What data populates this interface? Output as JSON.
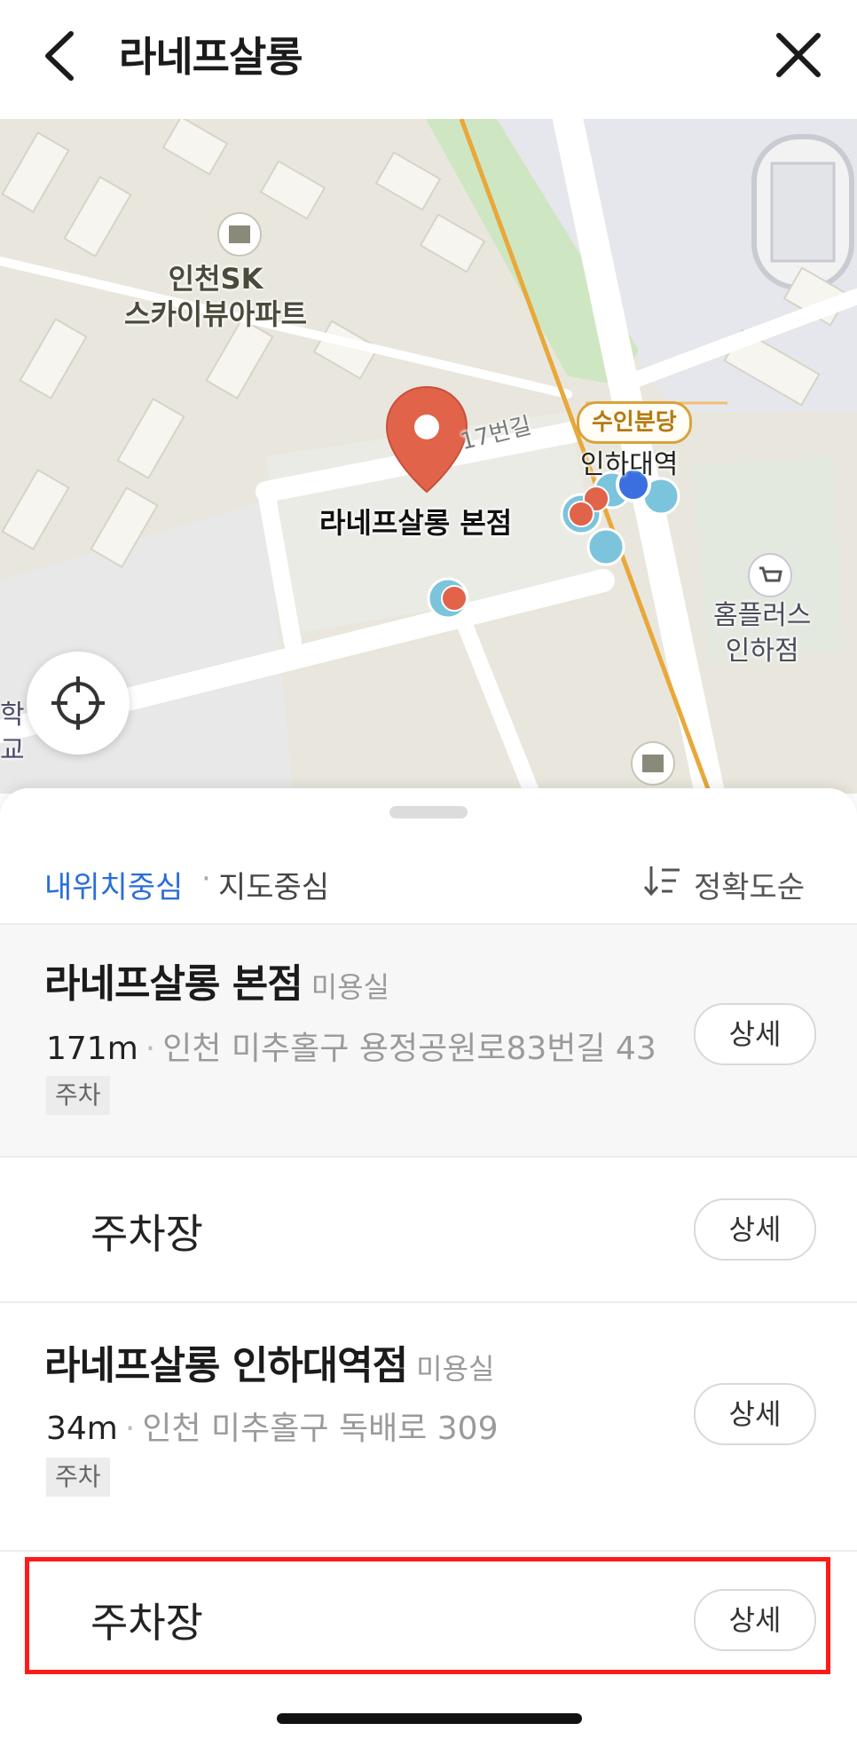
{
  "header": {
    "title": "라네프살롱",
    "back_icon": "chevron-left-icon",
    "close_icon": "close-icon"
  },
  "map": {
    "apartment_label_line1": "인천SK",
    "apartment_label_line2": "스카이뷰아파트",
    "road_label": "17번길",
    "station_badge": "수인분당",
    "station_name": "인하대역",
    "place_label": "라네프살롱 본점",
    "shop_label_line1": "홈플러스",
    "shop_label_line2": "인하점",
    "edge_label_line1": "학",
    "edge_label_line2": "교",
    "locate_icon": "crosshair-icon",
    "colors": {
      "marker": "#e0634a",
      "pin_blue": "#7cc4dc",
      "current_location": "#3b6fe0",
      "transit_line": "#e8a83a"
    }
  },
  "filters": {
    "my_location": "내위치중심",
    "map_center": "지도중심",
    "separator": "·",
    "sort_label": "정확도순",
    "sort_icon": "sort-descending-icon"
  },
  "results": [
    {
      "name": "라네프살롱 본점",
      "category": "미용실",
      "distance": "171m",
      "address": "인천 미추홀구 용정공원로83번길 43",
      "tag": "주차",
      "detail": "상세"
    },
    {
      "sub_label": "주차장",
      "detail": "상세"
    },
    {
      "name": "라네프살롱 인하대역점",
      "category": "미용실",
      "distance": "34m",
      "address": "인천 미추홀구 독배로 309",
      "tag": "주차",
      "detail": "상세"
    },
    {
      "sub_label": "주차장",
      "detail": "상세"
    }
  ],
  "colors": {
    "accent": "#2a6ed8",
    "highlight_border": "#ff1a1a"
  }
}
